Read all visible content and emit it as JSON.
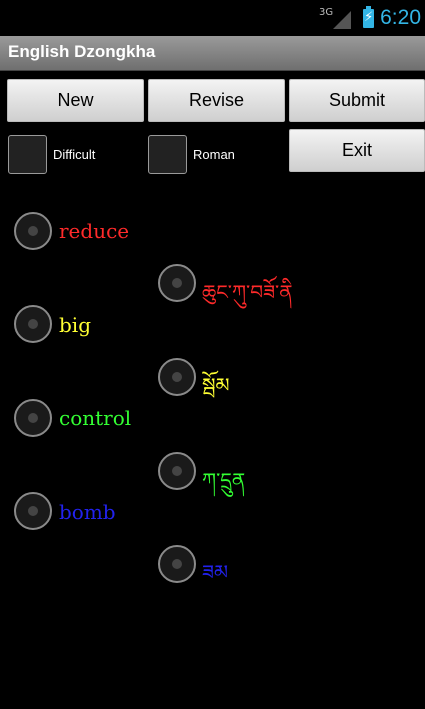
{
  "status": {
    "network": "3G",
    "time": "6:20"
  },
  "app": {
    "title": "English Dzongkha"
  },
  "buttons": {
    "new": "New",
    "revise": "Revise",
    "submit": "Submit",
    "exit": "Exit"
  },
  "options": {
    "difficult": "Difficult",
    "roman": "Roman"
  },
  "colors": {
    "accent": "#33b5e5",
    "red": "#ff2a2a",
    "yellow": "#ffff33",
    "green": "#33ff33",
    "blue": "#2222ee"
  },
  "english_words": [
    {
      "text": "reduce",
      "color": "#ff2a2a"
    },
    {
      "text": "big",
      "color": "#ffff33"
    },
    {
      "text": "control",
      "color": "#33ff33"
    },
    {
      "text": "bomb",
      "color": "#2222ee"
    }
  ],
  "dzongkha_words": [
    {
      "text": "ཆུང་ཀུ་བཟོ་ནི",
      "color": "#ff2a2a"
    },
    {
      "text": "སྦོམ",
      "color": "#ffff33"
    },
    {
      "text": "ཀ་དྲུན",
      "color": "#33ff33"
    },
    {
      "text": "ཟམ",
      "color": "#2222ee"
    }
  ]
}
